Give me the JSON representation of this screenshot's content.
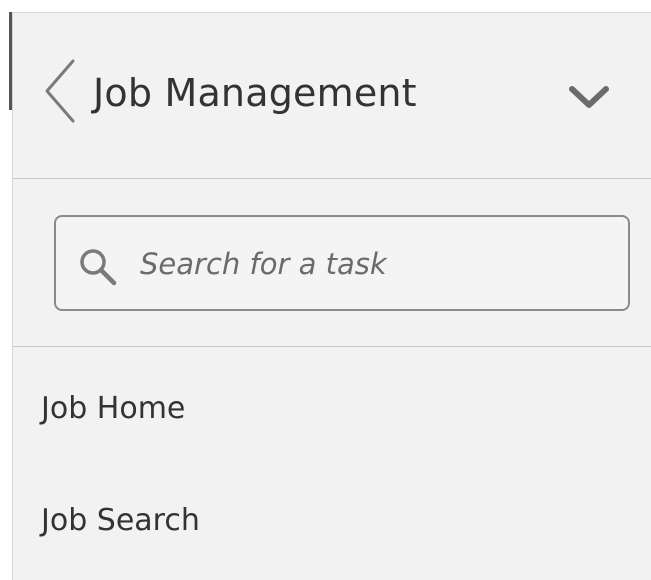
{
  "header": {
    "title": "Job Management"
  },
  "search": {
    "placeholder": "Search for a task",
    "value": ""
  },
  "nav": {
    "items": [
      {
        "label": "Job Home"
      },
      {
        "label": "Job Search"
      }
    ]
  },
  "icons": {
    "back": "chevron-left-icon",
    "expand": "chevron-down-icon",
    "search": "search-icon"
  }
}
